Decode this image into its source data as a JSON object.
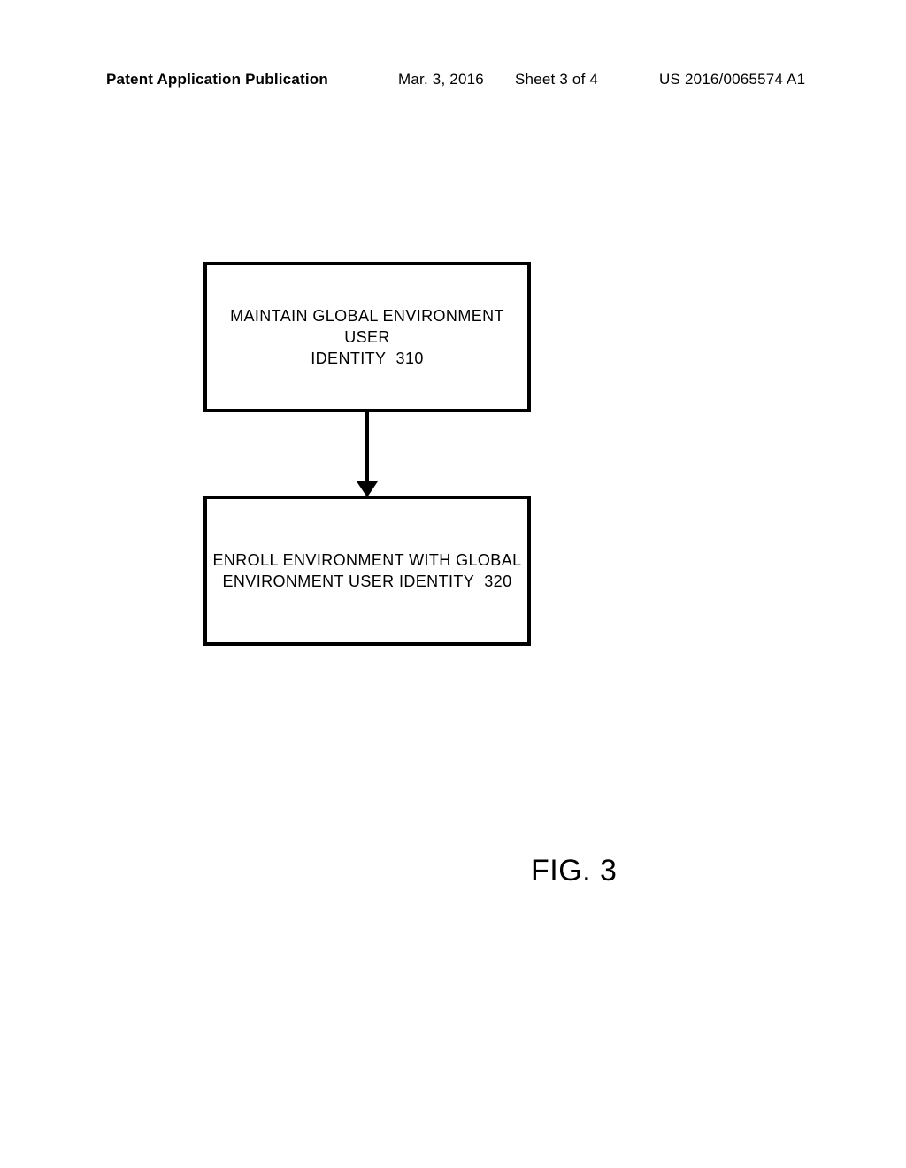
{
  "header": {
    "left": "Patent Application Publication",
    "date": "Mar. 3, 2016",
    "sheet": "Sheet 3 of 4",
    "pubno": "US 2016/0065574 A1"
  },
  "boxes": {
    "b1": {
      "line1": "MAINTAIN GLOBAL ENVIRONMENT USER",
      "line2_text": "IDENTITY",
      "ref": "310"
    },
    "b2": {
      "line1": "ENROLL ENVIRONMENT WITH GLOBAL",
      "line2_text": "ENVIRONMENT USER IDENTITY",
      "ref": "320"
    }
  },
  "figure_label": "FIG. 3",
  "chart_data": {
    "type": "flowchart",
    "nodes": [
      {
        "id": "310",
        "label": "MAINTAIN GLOBAL ENVIRONMENT USER IDENTITY"
      },
      {
        "id": "320",
        "label": "ENROLL ENVIRONMENT WITH GLOBAL ENVIRONMENT USER IDENTITY"
      }
    ],
    "edges": [
      {
        "from": "310",
        "to": "320"
      }
    ],
    "title": "FIG. 3"
  }
}
